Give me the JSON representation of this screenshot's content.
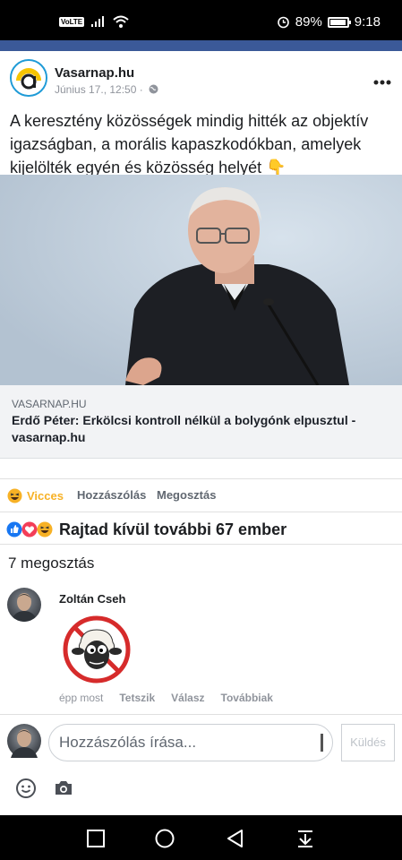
{
  "status_bar": {
    "volte": "VoLTE",
    "battery": "89%",
    "time": "9:18"
  },
  "post": {
    "page_name": "Vasarnap.hu",
    "time": "Június 17., 12:50 ·",
    "text": "A keresztény közösségek mindig hitték az objektív igazságban, a morális kapaszkodókban, amelyek kijelölték egyén és közösség helyét 👇",
    "link": {
      "domain": "VASARNAP.HU",
      "title": "Erdő Péter: Erkölcsi kontroll nélkül a bolygónk elpusztul - vasarnap.hu"
    }
  },
  "actions": {
    "reaction": "Vicces",
    "comment": "Hozzászólás",
    "share": "Megosztás"
  },
  "reactions_summary": "Rajtad kívül további 67 ember",
  "shares_count": "7 megosztás",
  "comment": {
    "author": "Zoltán Cseh",
    "time": "épp most",
    "like": "Tetszik",
    "reply": "Válasz",
    "more": "Továbbiak"
  },
  "composer": {
    "placeholder": "Hozzászólás írása...",
    "send": "Küldés"
  },
  "icons": {
    "status_left": [
      "volte-icon",
      "signal-icon",
      "wifi-icon"
    ],
    "status_right": [
      "alarm-icon",
      "battery-icon"
    ],
    "nav": [
      "recents-icon",
      "home-icon",
      "back-icon",
      "notification-shade-icon"
    ]
  },
  "colors": {
    "brand_blue": "#3b5998",
    "haha_yellow": "#f7b125",
    "like_blue": "#1877f2",
    "love_red": "#f33e58"
  }
}
